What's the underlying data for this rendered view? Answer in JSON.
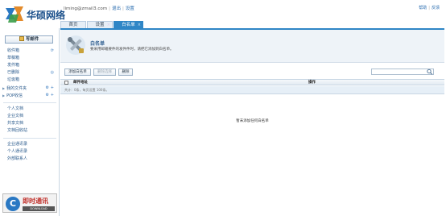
{
  "brand": {
    "name": "华硕网络"
  },
  "user": {
    "email": "liming@zmail3.com",
    "logout": "退出",
    "settings": "设置"
  },
  "top_links": {
    "help": "帮助",
    "feedback": "反馈"
  },
  "tabs": [
    {
      "label": "首页"
    },
    {
      "label": "设置"
    },
    {
      "label": "白名单"
    }
  ],
  "sidebar": {
    "compose": "写邮件",
    "items": [
      {
        "label": "收件箱"
      },
      {
        "label": "草稿箱"
      },
      {
        "label": "发件箱"
      },
      {
        "label": "已删除"
      },
      {
        "label": "垃圾箱"
      },
      {
        "label": "我的文件夹"
      },
      {
        "label": "POP收信"
      },
      {
        "label": "个人文档"
      },
      {
        "label": "企业文档"
      },
      {
        "label": "共享文档"
      },
      {
        "label": "文档回收站"
      },
      {
        "label": "企业通讯录"
      },
      {
        "label": "个人通讯录"
      },
      {
        "label": "外部联系人"
      }
    ]
  },
  "ad": {
    "title": "即时通讯",
    "sub": "DOWNLOAD"
  },
  "page": {
    "title": "白名单",
    "desc": "要采用邮箱要件的发件件时，请把它添加到白名单。"
  },
  "toolbar": {
    "add": "添加白名单",
    "delete_selected": "删除选择",
    "delete": "删除"
  },
  "table": {
    "col_address": "邮件地址",
    "col_operation": "操作"
  },
  "summary": "共计：0条，每页设置 100条。",
  "empty_message": "暂未添加任何白名单",
  "colors": {
    "accent": "#2f86c6",
    "link": "#2a5a8c",
    "ad_red": "#c0302a"
  },
  "icons": [
    "logo-icon",
    "compose-icon",
    "refresh-icon",
    "settings-icon",
    "search-icon",
    "tools-icon",
    "im-icon"
  ]
}
